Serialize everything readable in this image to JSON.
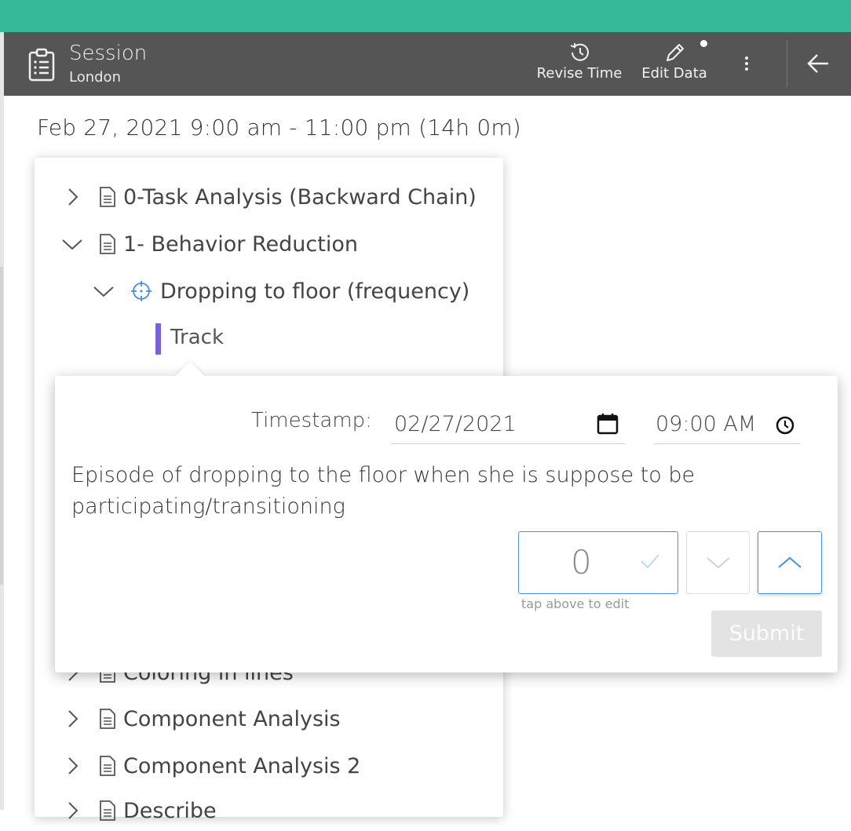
{
  "header": {
    "title": "Session",
    "subtitle": "London",
    "revise_time_label": "Revise Time",
    "edit_data_label": "Edit Data"
  },
  "session": {
    "date_range": "Feb 27, 2021 9:00 am - 11:00 pm (14h 0m)"
  },
  "tree": {
    "items": [
      {
        "label": "0-Task Analysis (Backward Chain)",
        "expanded": false
      },
      {
        "label": "1- Behavior Reduction",
        "expanded": true
      },
      {
        "label": "Dropping to floor (frequency)",
        "expanded": true,
        "icon": "target-icon"
      },
      {
        "label": "Track"
      },
      {
        "label": "Coloring in lines",
        "expanded": false
      },
      {
        "label": "Component Analysis",
        "expanded": false
      },
      {
        "label": "Component Analysis 2",
        "expanded": false
      },
      {
        "label": "Describe",
        "expanded": false
      }
    ]
  },
  "popup": {
    "timestamp_label": "Timestamp:",
    "date_value": "02/27/2021",
    "time_value": "09:00 AM",
    "description": "Episode of dropping to the floor when she is suppose to be participating/transitioning",
    "count_value": "0",
    "hint": "tap above to edit",
    "submit_label": "Submit"
  },
  "colors": {
    "accent_top": "#36b999",
    "header_bg": "#555555",
    "track_bar": "#7b61d9",
    "focus_blue": "#4a90e2"
  }
}
